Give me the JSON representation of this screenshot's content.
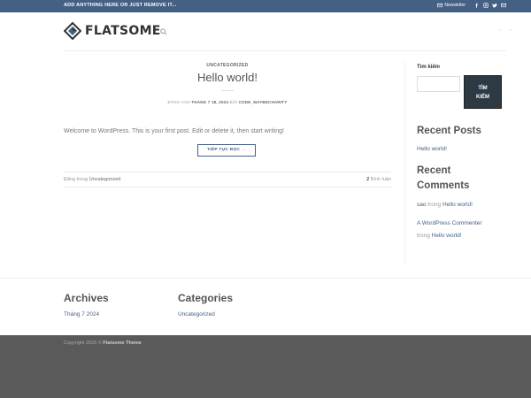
{
  "topbar": {
    "promo": "ADD ANYTHING HERE OR JUST REMOVE IT...",
    "newsletter": "Newsletter",
    "social_icons": [
      "facebook-icon",
      "instagram-icon",
      "twitter-icon",
      "envelope-icon"
    ]
  },
  "header": {
    "logo_text": "FLATSOME",
    "nav_right": [
      "◦",
      "◦"
    ]
  },
  "post": {
    "category": "UNCATEGORIZED",
    "title": "Hello world!",
    "meta_prefix": "ĐĂNG VÀO",
    "meta_date": "THÁNG 7 18, 2024",
    "meta_by": "BỞI",
    "meta_author": "CODE_MAYBECHARITY",
    "excerpt": "Welcome to WordPress. This is your first post. Edit or delete it, then start writing!",
    "read_more": "TIẾP TỤC ĐỌC →",
    "footer_prefix": "Đăng trong",
    "footer_category": "Uncategorized",
    "comment_count": "2",
    "comment_label": "Bình luận"
  },
  "sidebar": {
    "search_label": "Tìm kiếm",
    "search_placeholder": "",
    "search_button_line1": "TÌM",
    "search_button_line2": "KIẾM",
    "recent_posts_title": "Recent Posts",
    "recent_posts": [
      "Hello world!"
    ],
    "recent_comments_title_line1": "Recent",
    "recent_comments_title_line2": "Comments",
    "comment1_author": "sao",
    "comment1_in": "trong",
    "comment1_post": "Hello world!",
    "comment2_author": "A WordPress Commenter",
    "comment2_in": "trong",
    "comment2_post": "Hello world!"
  },
  "footer_widgets": {
    "archives_title": "Archives",
    "archives_item": "Tháng 7 2024",
    "categories_title": "Categories",
    "categories_item": "Uncategorized"
  },
  "footer": {
    "copyright_prefix": "Copyright 2025 ©",
    "copyright_brand": "Flatsome Theme"
  },
  "colors": {
    "primary": "#446084",
    "footer_bg": "#5a5a5a",
    "button_dark": "#2d3a43"
  }
}
